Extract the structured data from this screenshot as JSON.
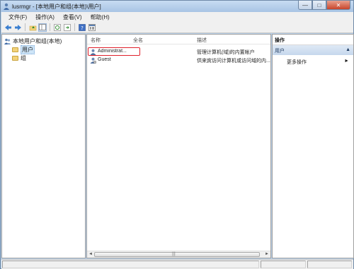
{
  "window": {
    "title": "lusrmgr - [本地用户和组(本地)\\用户]",
    "minimize_glyph": "—",
    "maximize_glyph": "□",
    "close_glyph": "✕"
  },
  "menu": {
    "items": [
      "文件(F)",
      "操作(A)",
      "查看(V)",
      "帮助(H)"
    ]
  },
  "toolbar": {
    "icons": [
      "back-arrow-icon",
      "forward-arrow-icon",
      "up-folder-icon",
      "show-hide-tree-icon",
      "refresh-icon",
      "export-list-icon",
      "help-icon",
      "console-icon"
    ]
  },
  "tree": {
    "root_label": "本地用户和组(本地)",
    "items": [
      {
        "label": "用户",
        "selected": true
      },
      {
        "label": "组",
        "selected": false
      }
    ]
  },
  "list": {
    "columns": [
      "名称",
      "全名",
      "描述"
    ],
    "rows": [
      {
        "name": "Administrat...",
        "full_name": "",
        "description": "管理计算机(域)的内置帐户",
        "highlighted": true
      },
      {
        "name": "Guest",
        "full_name": "",
        "description": "供来宾访问计算机或访问域的内...",
        "highlighted": false
      }
    ],
    "scroll_left": "◄",
    "scroll_right": "►",
    "scroll_grip": "|||"
  },
  "actions": {
    "title": "操作",
    "section": "用户",
    "section_caret": "▲",
    "more_label": "更多操作",
    "more_caret": "►"
  },
  "colors": {
    "highlight_border": "#e0202a",
    "title_bar": "#b9d1ea",
    "action_section": "#c5d7ed"
  }
}
